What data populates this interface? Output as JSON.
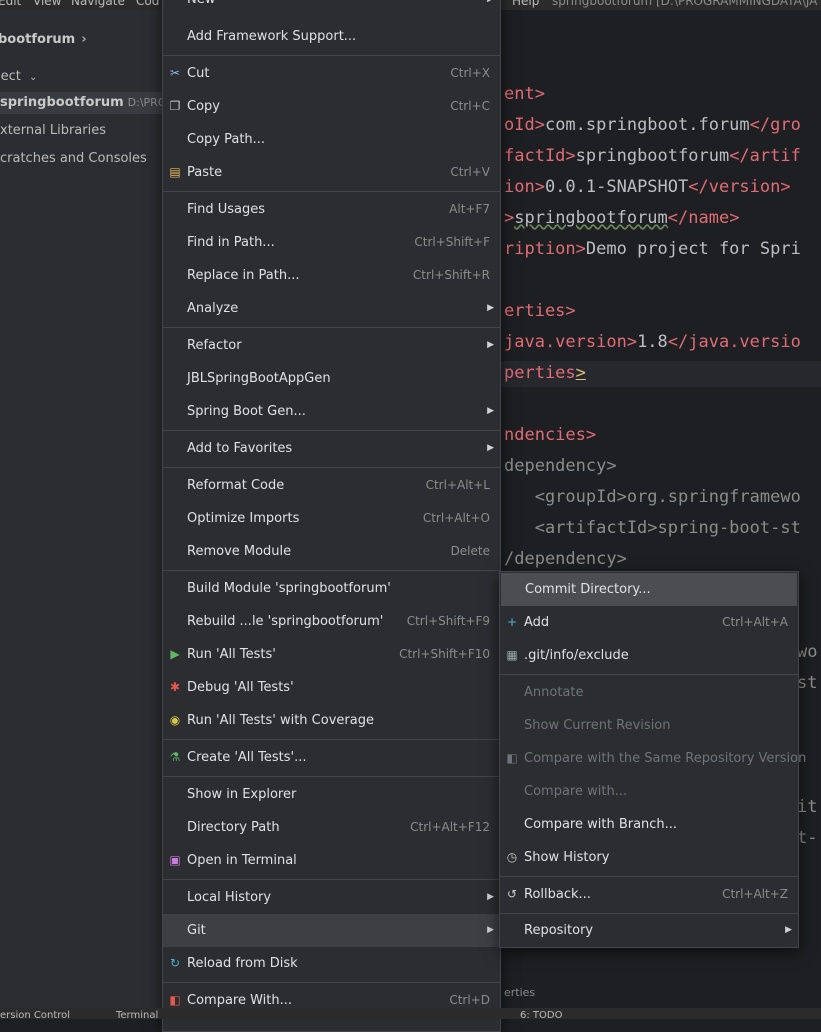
{
  "menubar": {
    "items": [
      "Edit",
      "View",
      "Navigate",
      "Cod",
      "Help"
    ],
    "title": "springbootforum [D:\\PROGRAMMINGDATA\\JA"
  },
  "project_panel": {
    "crumb": "bootforum",
    "selector": "ject",
    "tree": [
      {
        "label": "springbootforum",
        "path": "D:\\PROGR"
      },
      {
        "label": "xternal Libraries"
      },
      {
        "label": "cratches and Consoles"
      }
    ]
  },
  "editor": {
    "lines": [
      {
        "p1": "ent>",
        "p2": "",
        "p3": ""
      },
      {
        "p1": "oId>",
        "p2": "com.springboot.forum",
        "p3": "</gro"
      },
      {
        "p1": "factId>",
        "p2": "springbootforum",
        "p3": "</artif"
      },
      {
        "p1": "ion>",
        "p2": "0.0.1-SNAPSHOT",
        "p3": "</version>"
      },
      {
        "p1": ">",
        "p2": "springbootforum",
        "p3": "</name>"
      },
      {
        "p1": "ription>",
        "p2": "Demo project for Spri",
        "p3": ""
      },
      {
        "p1": "erties>",
        "p2": "",
        "p3": ""
      },
      {
        "p1": "java.version>",
        "p2": "1.8",
        "p3": "</java.versio"
      },
      {
        "p1": "perties",
        "p2": ">",
        "p3": ""
      },
      {
        "p1": "ndencies>",
        "p2": "",
        "p3": ""
      },
      {
        "p1": "dependency>",
        "p2": "",
        "p3": ""
      },
      {
        "p1": "   <groupId>",
        "p2": "org.springframewo",
        "p3": ""
      },
      {
        "p1": "   <artifactId>",
        "p2": "spring-boot-st",
        "p3": ""
      },
      {
        "p1": "/dependency>",
        "p2": "",
        "p3": ""
      },
      {
        "p1": "",
        "p2": "wo",
        "p3": ""
      },
      {
        "p1": "",
        "p2": "st",
        "p3": ""
      },
      {
        "p1": "",
        "p2": "it",
        "p3": ""
      },
      {
        "p1": "",
        "p2": "t-",
        "p3": ""
      }
    ],
    "breadcrumb": "erties"
  },
  "context_menu": {
    "items": [
      {
        "label": "New",
        "submenu": true
      },
      {
        "label": "Add Framework Support..."
      },
      {
        "label": "Cut",
        "shortcut": "Ctrl+X",
        "icon": "cut-icon"
      },
      {
        "label": "Copy",
        "shortcut": "Ctrl+C",
        "icon": "copy-icon"
      },
      {
        "label": "Copy Path..."
      },
      {
        "label": "Paste",
        "shortcut": "Ctrl+V",
        "icon": "paste-icon"
      },
      {
        "label": "Find Usages",
        "shortcut": "Alt+F7"
      },
      {
        "label": "Find in Path...",
        "shortcut": "Ctrl+Shift+F"
      },
      {
        "label": "Replace in Path...",
        "shortcut": "Ctrl+Shift+R"
      },
      {
        "label": "Analyze",
        "submenu": true
      },
      {
        "label": "Refactor",
        "submenu": true
      },
      {
        "label": "JBLSpringBootAppGen"
      },
      {
        "label": "Spring Boot Gen...",
        "submenu": true
      },
      {
        "label": "Add to Favorites",
        "submenu": true
      },
      {
        "label": "Reformat Code",
        "shortcut": "Ctrl+Alt+L"
      },
      {
        "label": "Optimize Imports",
        "shortcut": "Ctrl+Alt+O"
      },
      {
        "label": "Remove Module",
        "shortcut": "Delete"
      },
      {
        "label": "Build Module 'springbootforum'"
      },
      {
        "label": "Rebuild ...le 'springbootforum'",
        "shortcut": "Ctrl+Shift+F9"
      },
      {
        "label": "Run 'All Tests'",
        "shortcut": "Ctrl+Shift+F10",
        "icon": "run-icon"
      },
      {
        "label": "Debug 'All Tests'",
        "icon": "debug-icon"
      },
      {
        "label": "Run 'All Tests' with Coverage",
        "icon": "coverage-icon"
      },
      {
        "label": "Create 'All Tests'...",
        "icon": "test-icon"
      },
      {
        "label": "Show in Explorer"
      },
      {
        "label": "Directory Path",
        "shortcut": "Ctrl+Alt+F12"
      },
      {
        "label": "Open in Terminal",
        "icon": "terminal-icon"
      },
      {
        "label": "Local History",
        "submenu": true
      },
      {
        "label": "Git",
        "submenu": true
      },
      {
        "label": "Reload from Disk",
        "icon": "reload-icon"
      },
      {
        "label": "Compare With...",
        "shortcut": "Ctrl+D",
        "icon": "compare-icon"
      }
    ]
  },
  "git_submenu": {
    "items": [
      {
        "label": "Commit Directory..."
      },
      {
        "label": "Add",
        "shortcut": "Ctrl+Alt+A",
        "icon": "plus-icon"
      },
      {
        "label": ".git/info/exclude",
        "icon": "file-icon"
      },
      {
        "label": "Annotate",
        "disabled": true
      },
      {
        "label": "Show Current Revision",
        "disabled": true
      },
      {
        "label": "Compare with the Same Repository Version",
        "disabled": true,
        "icon": "compare-icon"
      },
      {
        "label": "Compare with...",
        "disabled": true
      },
      {
        "label": "Compare with Branch..."
      },
      {
        "label": "Show History",
        "icon": "history-icon"
      },
      {
        "label": "Rollback...",
        "shortcut": "Ctrl+Alt+Z",
        "icon": "rollback-icon"
      },
      {
        "label": "Repository",
        "submenu": true
      }
    ]
  },
  "status_bar": {
    "items": [
      "ersion Control",
      "Terminal",
      "6: TODO"
    ]
  },
  "colors": {
    "menu_bg": "#2b2d30",
    "editor_bg": "#1e1f22",
    "xml_tag": "#e06c75",
    "highlight": "#3d3f43"
  }
}
